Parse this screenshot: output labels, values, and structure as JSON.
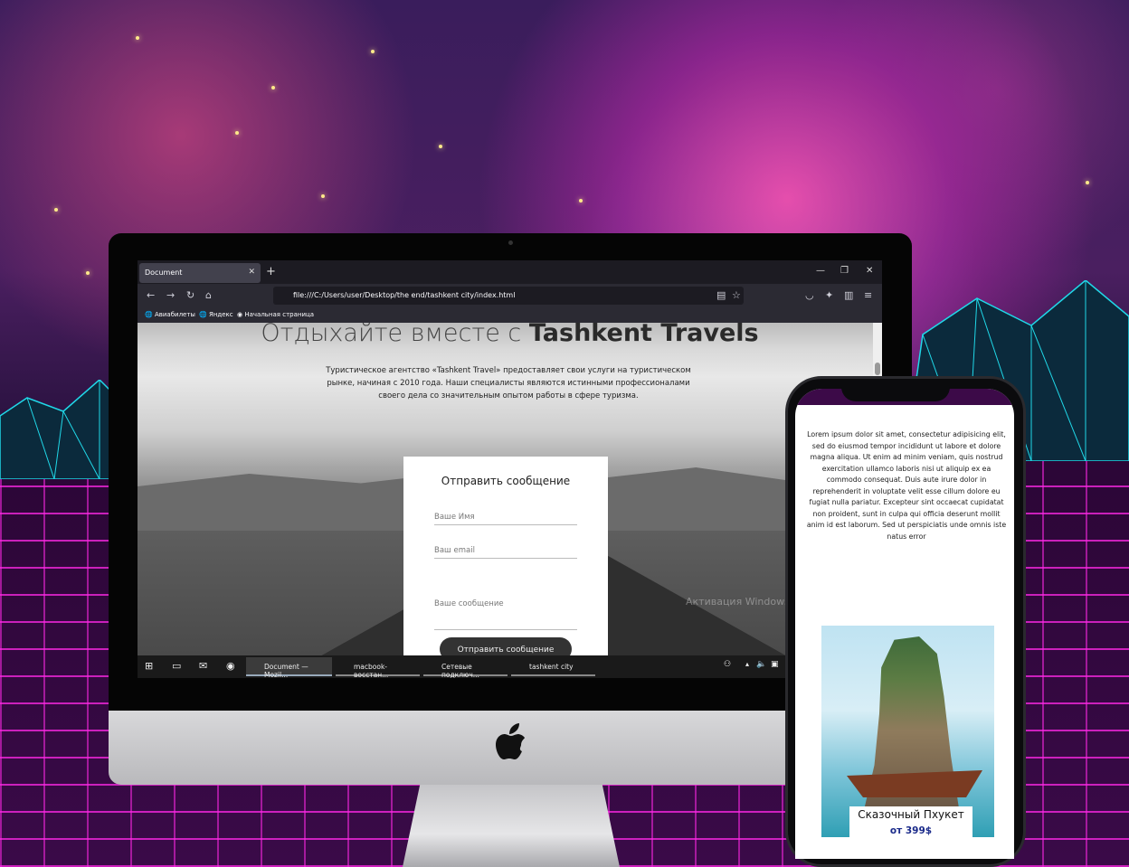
{
  "browser": {
    "tab_title": "Document",
    "tab_close": "✕",
    "new_tab": "+",
    "url": "file:///C:/Users/user/Desktop/the end/tashkent city/index.html",
    "bookmarks": [
      "Авиабилеты",
      "Яндекс",
      "Начальная страница"
    ]
  },
  "hero": {
    "title_light": "Отдыхайте вместе с",
    "title_bold": "Tashkent Travels",
    "description": "Туристическое агентство «Tashkent Travel» предоставляет свои услуги на туристическом рынке, начиная с 2010 года. Наши специалисты являются истинными профессионалами своего дела со значительным опытом работы в сфере туризма."
  },
  "contact_form": {
    "title": "Отправить сообщение",
    "name_placeholder": "Ваше Имя",
    "email_placeholder": "Ваш email",
    "message_placeholder": "Ваше сообщение",
    "submit_label": "Отправить сообщение"
  },
  "watermark": "Активация Windows",
  "taskbar": {
    "apps": [
      "Document — Mozil...",
      "macbook-восстан...",
      "Сетевые подключ...",
      "tashkent city"
    ]
  },
  "phone": {
    "lorem": "Lorem ipsum dolor sit amet, consectetur adipisicing elit, sed do eiusmod tempor incididunt ut labore et dolore magna aliqua. Ut enim ad minim veniam, quis nostrud exercitation ullamco laboris nisi ut aliquip ex ea commodo consequat. Duis aute irure dolor in reprehenderit in voluptate velit esse cillum dolore eu fugiat nulla pariatur. Excepteur sint occaecat cupidatat non proident, sunt in culpa qui officia deserunt mollit anim id est laborum. Sed ut perspiciatis unde omnis iste natus error",
    "card_title": "Сказочный Пхукет",
    "card_price": "от 399$"
  },
  "colors": {
    "grid": "#ff28e6",
    "price": "#1a2a8a",
    "phone_header": "#3c0a48"
  }
}
